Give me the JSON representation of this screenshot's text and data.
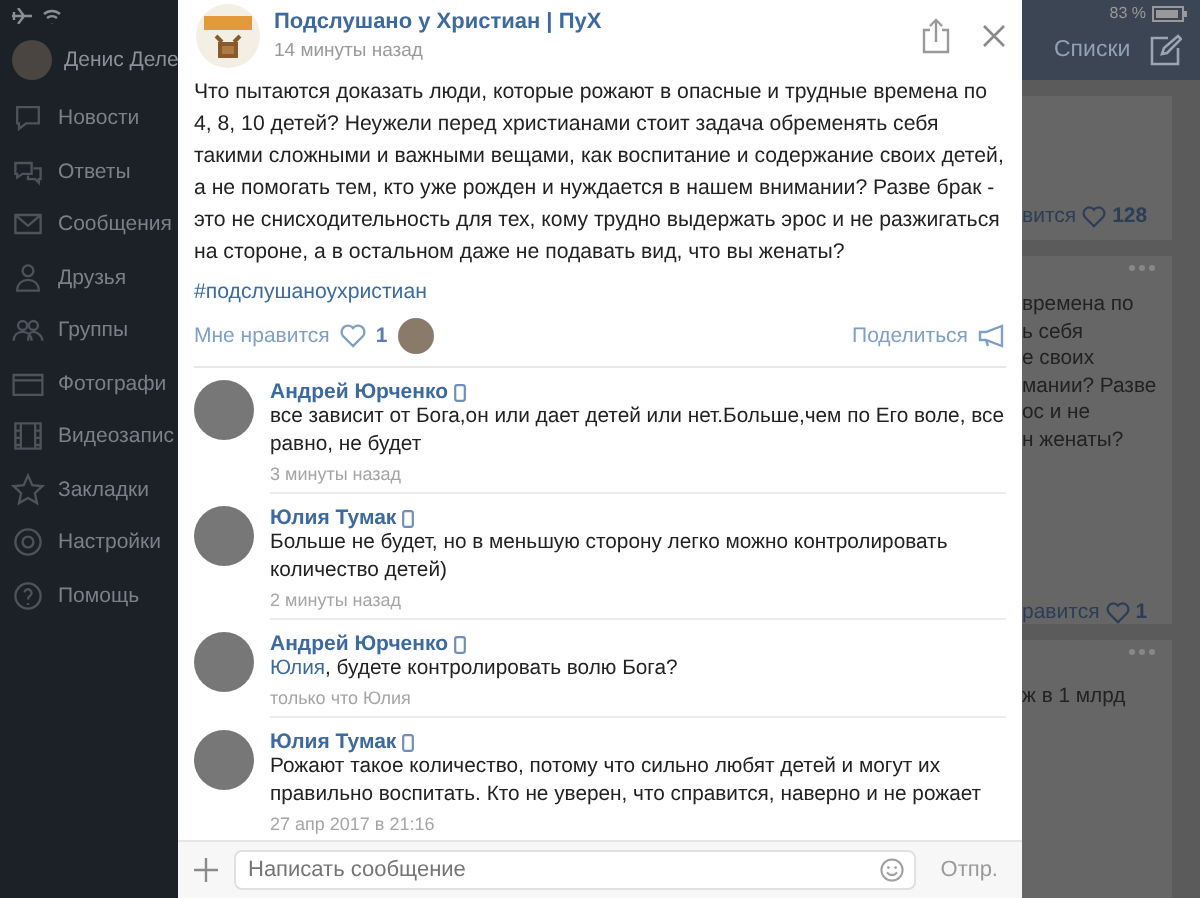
{
  "status_bar": {
    "battery": "83 %"
  },
  "sidebar": {
    "profile_name": "Денис Деле",
    "items": [
      {
        "label": "Новости"
      },
      {
        "label": "Ответы"
      },
      {
        "label": "Сообщения"
      },
      {
        "label": "Друзья"
      },
      {
        "label": "Группы"
      },
      {
        "label": "Фотографи"
      },
      {
        "label": "Видеозапис"
      },
      {
        "label": "Закладки"
      },
      {
        "label": "Настройки"
      },
      {
        "label": "Помощь"
      }
    ]
  },
  "post": {
    "author": "Подслушано у Христиан | ПуХ",
    "time": "14 минуты назад",
    "text": "Что пытаются доказать люди, которые рожают в опасные и трудные времена по 4, 8, 10 детей? Неужели перед христианами стоит задача обременять себя такими сложными и важными вещами, как воспитание и содержание своих детей, а не помогать тем, кто уже рожден и нуждается в нашем внимании? Разве брак - это не снисходительность для тех, кому трудно выдержать эрос и не разжигаться на стороне, а в остальном даже не подавать вид, что вы женаты?",
    "hashtag": "#подслушаноухристиан",
    "like_label": "Мне нравится",
    "like_count": "1",
    "share_label": "Поделиться"
  },
  "comments": [
    {
      "name": "Андрей Юрченко",
      "text": "все зависит от Бога,он или дает детей или нет.Больше,чем по Его воле, все равно, не будет",
      "time": "3 минуты назад"
    },
    {
      "name": "Юлия Тумак",
      "text": "Больше не будет, но в меньшую сторону легко можно контролировать количество детей)",
      "time": "2 минуты назад"
    },
    {
      "name": "Андрей Юрченко",
      "mention": "Юлия",
      "text": ", будете контролировать волю Бога?",
      "time": "только что Юлия"
    },
    {
      "name": "Юлия Тумак",
      "text": "Рожают такое количество, потому что сильно любят детей и могут их правильно воспитать. Кто не уверен, что справится, наверно и не рожает",
      "time": "27 апр 2017 в 21:16"
    }
  ],
  "composer": {
    "placeholder": "Написать сообщение",
    "send_button": "Отпр."
  },
  "background_feed": {
    "header_button": "Списки",
    "card_1": {
      "likes_label": "вится",
      "likes_count": "128"
    },
    "card_2": {
      "text_lines": [
        "времена по",
        "ь себя",
        "е своих",
        "мании? Разве",
        "ос и не",
        "н женаты?"
      ],
      "likes_label": "равится",
      "likes_count": "1"
    },
    "card_3": {
      "text": "ж в 1 млрд"
    }
  }
}
